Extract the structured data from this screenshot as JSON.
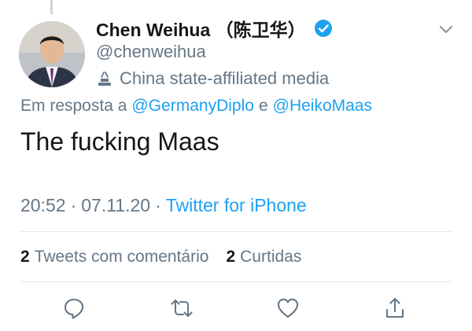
{
  "tweet": {
    "author": {
      "name": "Chen Weihua （陈卫华）",
      "handle": "@chenweihua",
      "label": "China state-affiliated media"
    },
    "reply_prefix": "Em resposta a",
    "reply_mentions": [
      "@GermanyDiplo",
      "@HeikoMaas"
    ],
    "reply_joiner": "e",
    "text": "The fucking Maas",
    "time": "20:52",
    "separator": "·",
    "date": "07.11.20",
    "source": "Twitter for iPhone",
    "stats": {
      "quote_count": "2",
      "quote_label": "Tweets com comentário",
      "like_count": "2",
      "like_label": "Curtidas"
    }
  },
  "icons": {
    "verified": "verified-badge-icon",
    "label": "state-media-podium-icon",
    "menu": "chevron-down-icon",
    "reply": "reply-icon",
    "retweet": "retweet-icon",
    "like": "heart-icon",
    "share": "share-icon"
  },
  "colors": {
    "accent": "#1da1f2",
    "secondary_text": "#657786",
    "primary_text": "#14171a",
    "divider": "#e1e8ed"
  }
}
